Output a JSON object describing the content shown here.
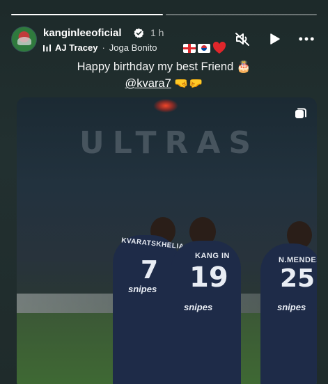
{
  "progress": {
    "segments": 2,
    "active_index": 0
  },
  "author": {
    "username": "kanginleeoficial",
    "verified": true,
    "time_ago": "1 h"
  },
  "music": {
    "artist": "AJ Tracey",
    "separator": "·",
    "song": "Joga Bonito"
  },
  "controls": {
    "mute_icon": "speaker-muted-icon",
    "play_icon": "play-icon",
    "more_icon": "more-horizontal-icon"
  },
  "overlay": {
    "flags": [
      "georgia-flag-icon",
      "south-korea-flag-icon"
    ],
    "heart_color": "#e0262b"
  },
  "caption": {
    "line1": "Happy birthday my best Friend 🎂",
    "mention": "@kvara7",
    "line2_emoji": "🤜🤛"
  },
  "photo": {
    "banner_text": "ULTRAS",
    "players": [
      {
        "name": "KVARATSKHELIA",
        "number": "7",
        "sponsor": "snipes"
      },
      {
        "name": "KANG IN",
        "number": "19",
        "sponsor": "snipes"
      },
      {
        "name": "N.MENDES",
        "number": "25",
        "sponsor": "snipes"
      }
    ]
  }
}
